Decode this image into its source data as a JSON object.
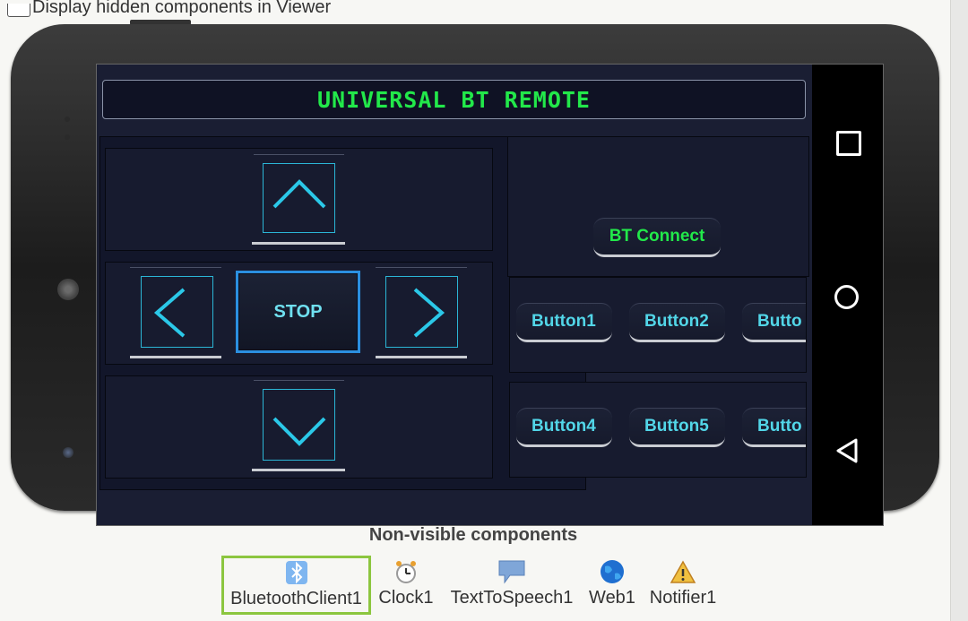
{
  "viewer_option": {
    "label": "Display hidden components in Viewer",
    "checked": false
  },
  "app": {
    "title": "UNIVERSAL BT REMOTE",
    "stop_label": "STOP",
    "connect_label": "BT Connect",
    "row1_buttons": [
      "Button1",
      "Button2",
      "Butto"
    ],
    "row2_buttons": [
      "Button4",
      "Button5",
      "Butto"
    ]
  },
  "non_visible": {
    "title": "Non-visible components",
    "items": [
      {
        "name": "BluetoothClient1",
        "icon": "bluetooth-icon",
        "selected": true
      },
      {
        "name": "Clock1",
        "icon": "clock-icon",
        "selected": false
      },
      {
        "name": "TextToSpeech1",
        "icon": "speech-bubble-icon",
        "selected": false
      },
      {
        "name": "Web1",
        "icon": "globe-icon",
        "selected": false
      },
      {
        "name": "Notifier1",
        "icon": "warning-icon",
        "selected": false
      }
    ]
  },
  "colors": {
    "title_green": "#22e84a",
    "button_cyan": "#52d6e8",
    "border_blue": "#2b8fe0",
    "selection_green": "#8cc63f"
  }
}
